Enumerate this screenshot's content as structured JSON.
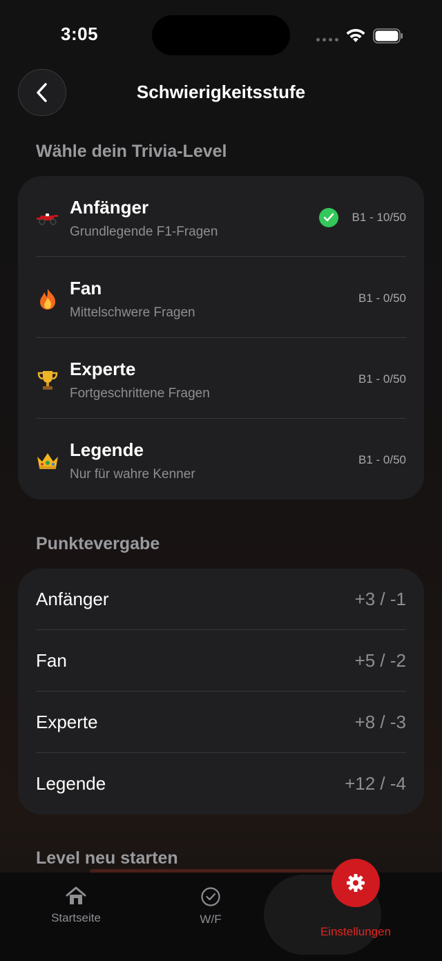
{
  "status_bar": {
    "time": "3:05"
  },
  "header": {
    "title": "Schwierigkeitsstufe"
  },
  "level_section": {
    "title": "Wähle dein Trivia-Level",
    "levels": [
      {
        "name": "Anfänger",
        "description": "Grundlegende F1-Fragen",
        "meta": "B1 - 10/50",
        "selected": true,
        "icon": "race-car-icon"
      },
      {
        "name": "Fan",
        "description": "Mittelschwere Fragen",
        "meta": "B1 - 0/50",
        "selected": false,
        "icon": "fire-icon"
      },
      {
        "name": "Experte",
        "description": "Fortgeschrittene Fragen",
        "meta": "B1 - 0/50",
        "selected": false,
        "icon": "trophy-icon"
      },
      {
        "name": "Legende",
        "description": "Nur für wahre Kenner",
        "meta": "B1 - 0/50",
        "selected": false,
        "icon": "crown-icon"
      }
    ]
  },
  "points_section": {
    "title": "Punktevergabe",
    "rows": [
      {
        "label": "Anfänger",
        "value": "+3 / -1"
      },
      {
        "label": "Fan",
        "value": "+5 / -2"
      },
      {
        "label": "Experte",
        "value": "+8 / -3"
      },
      {
        "label": "Legende",
        "value": "+12 / -4"
      }
    ]
  },
  "restart_section": {
    "title": "Level neu starten"
  },
  "tab_bar": {
    "tabs": [
      {
        "label": "Startseite",
        "icon": "home-icon"
      },
      {
        "label": "W/F",
        "icon": "check-circle-icon"
      },
      {
        "label": "Einstellungen",
        "icon": "gear-icon",
        "active": true
      }
    ]
  },
  "colors": {
    "accent": "#d11a1f",
    "success": "#34c759",
    "card": "#1f1f21"
  }
}
